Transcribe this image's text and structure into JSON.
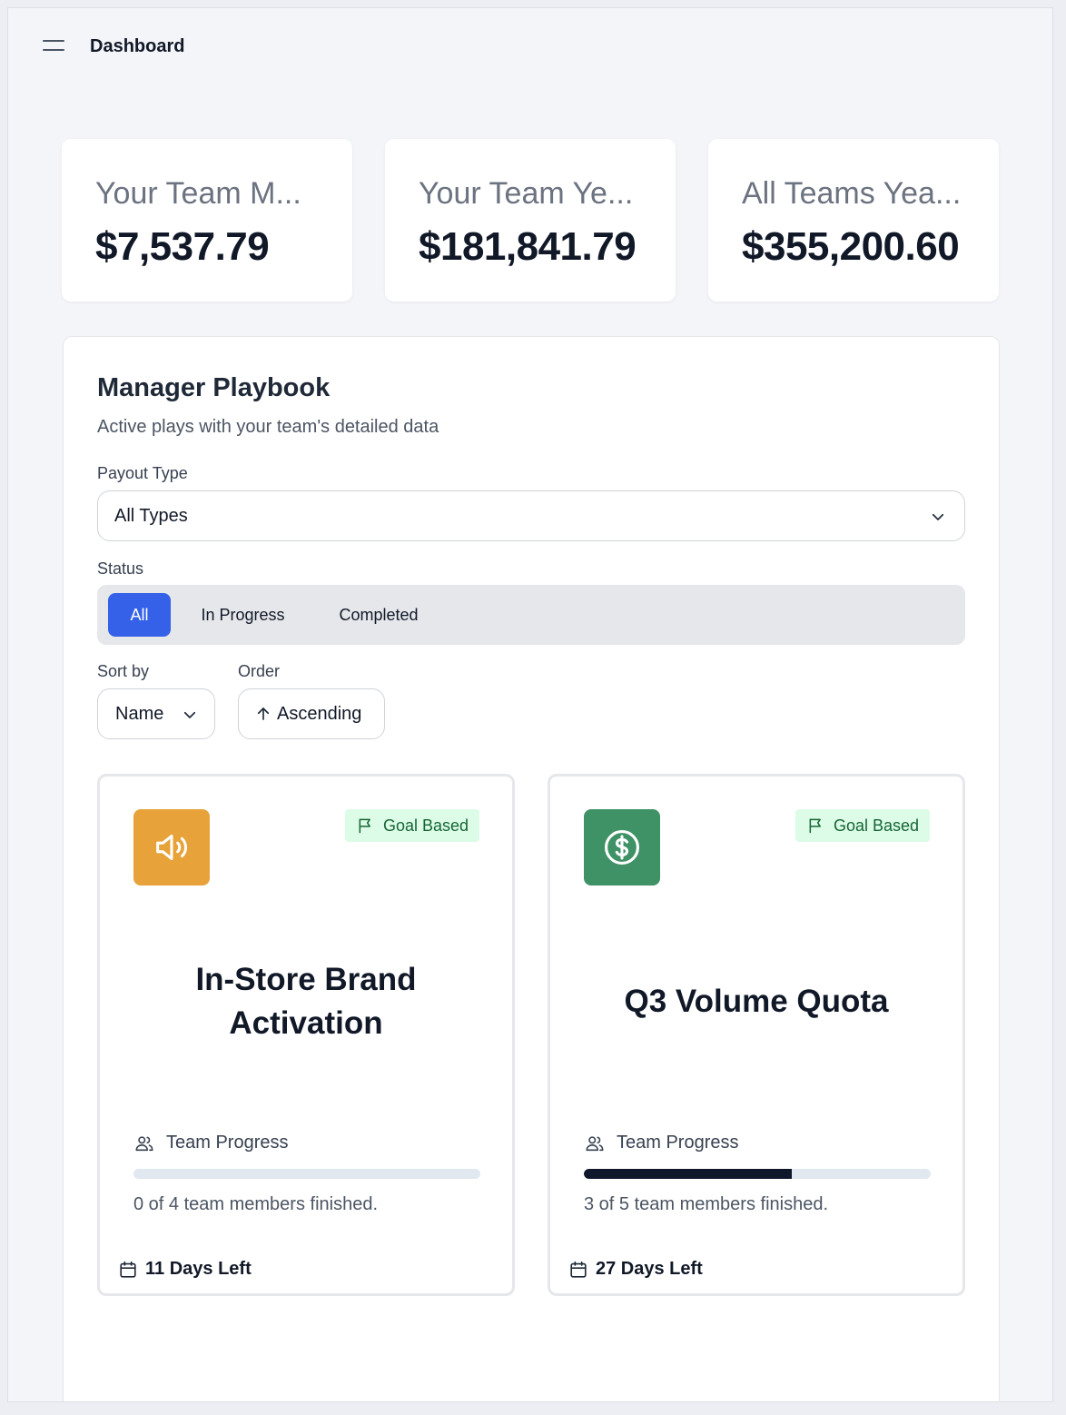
{
  "header": {
    "title": "Dashboard"
  },
  "stats": [
    {
      "label": "Your Team M...",
      "value": "$7,537.79"
    },
    {
      "label": "Your Team Ye...",
      "value": "$181,841.79"
    },
    {
      "label": "All Teams Yea...",
      "value": "$355,200.60"
    }
  ],
  "playbook": {
    "title": "Manager Playbook",
    "subtitle": "Active plays with your team's detailed data",
    "payout_label": "Payout Type",
    "payout_value": "All Types",
    "status_label": "Status",
    "status_options": [
      "All",
      "In Progress",
      "Completed"
    ],
    "status_selected": "All",
    "sort_label": "Sort by",
    "sort_value": "Name",
    "order_label": "Order",
    "order_value": "Ascending",
    "cards": [
      {
        "badge": "Goal Based",
        "title": "In-Store Brand Activation",
        "icon": "megaphone-icon",
        "icon_color": "#e8a23a",
        "progress_label": "Team Progress",
        "progress": 0.0,
        "finished_text": "0 of 4 team members finished.",
        "days_left": "11 Days Left"
      },
      {
        "badge": "Goal Based",
        "title": "Q3 Volume Quota",
        "icon": "dollar-icon",
        "icon_color": "#3f9265",
        "progress_label": "Team Progress",
        "progress": 0.6,
        "finished_text": "3 of 5 team members finished.",
        "days_left": "27 Days Left"
      }
    ]
  },
  "colors": {
    "accent": "#3461e8",
    "badge_bg": "#dcfce7",
    "badge_text": "#166534",
    "progress_fill": "#0f172a"
  }
}
